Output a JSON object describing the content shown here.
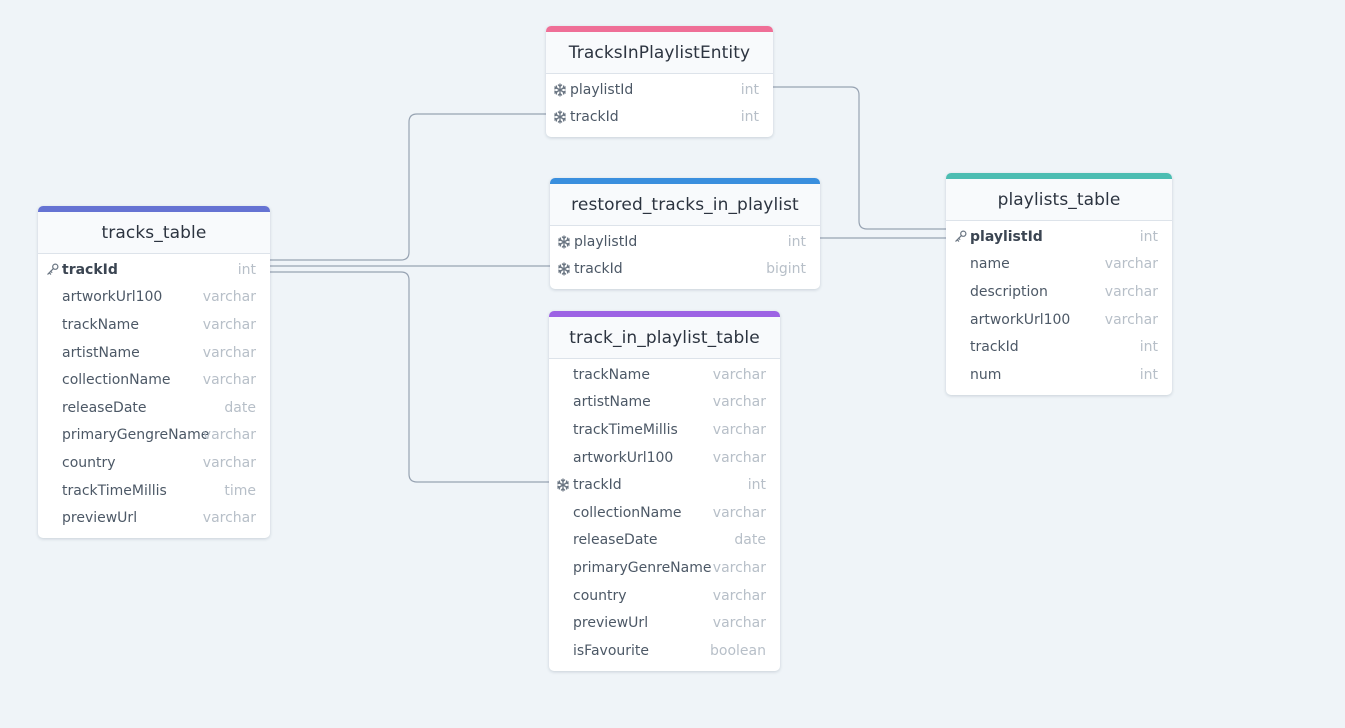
{
  "colors": {
    "background": "#eff4f8",
    "connector": "#97a3b2",
    "tracks_table": "#6573d3",
    "tracks_in_playlist_entity": "#ef6f97",
    "restored_tracks_in_playlist": "#3a8fde",
    "track_in_playlist_table": "#9d63e4",
    "playlists_table": "#4cbdb2"
  },
  "tables": {
    "tracks_table": {
      "title": "tracks_table",
      "color": "#6573d3",
      "fields": [
        {
          "name": "trackId",
          "type": "int",
          "marker": "key-icon",
          "pk": true
        },
        {
          "name": "artworkUrl100",
          "type": "varchar",
          "marker": "",
          "pk": false
        },
        {
          "name": "trackName",
          "type": "varchar",
          "marker": "",
          "pk": false
        },
        {
          "name": "artistName",
          "type": "varchar",
          "marker": "",
          "pk": false
        },
        {
          "name": "collectionName",
          "type": "varchar",
          "marker": "",
          "pk": false
        },
        {
          "name": "releaseDate",
          "type": "date",
          "marker": "",
          "pk": false
        },
        {
          "name": "primaryGengreName",
          "type": "varchar",
          "marker": "",
          "pk": false
        },
        {
          "name": "country",
          "type": "varchar",
          "marker": "",
          "pk": false
        },
        {
          "name": "trackTimeMillis",
          "type": "time",
          "marker": "",
          "pk": false
        },
        {
          "name": "previewUrl",
          "type": "varchar",
          "marker": "",
          "pk": false
        }
      ]
    },
    "tracks_in_playlist_entity": {
      "title": "TracksInPlaylistEntity",
      "color": "#ef6f97",
      "fields": [
        {
          "name": "playlistId",
          "type": "int",
          "marker": "snowflake-icon",
          "pk": false
        },
        {
          "name": "trackId",
          "type": "int",
          "marker": "snowflake-icon",
          "pk": false
        }
      ]
    },
    "restored_tracks_in_playlist": {
      "title": "restored_tracks_in_playlist",
      "color": "#3a8fde",
      "fields": [
        {
          "name": "playlistId",
          "type": "int",
          "marker": "snowflake-icon",
          "pk": false
        },
        {
          "name": "trackId",
          "type": "bigint",
          "marker": "snowflake-icon",
          "pk": false
        }
      ]
    },
    "track_in_playlist_table": {
      "title": "track_in_playlist_table",
      "color": "#9d63e4",
      "fields": [
        {
          "name": "trackName",
          "type": "varchar",
          "marker": "",
          "pk": false
        },
        {
          "name": "artistName",
          "type": "varchar",
          "marker": "",
          "pk": false
        },
        {
          "name": "trackTimeMillis",
          "type": "varchar",
          "marker": "",
          "pk": false
        },
        {
          "name": "artworkUrl100",
          "type": "varchar",
          "marker": "",
          "pk": false
        },
        {
          "name": "trackId",
          "type": "int",
          "marker": "snowflake-icon",
          "pk": false
        },
        {
          "name": "collectionName",
          "type": "varchar",
          "marker": "",
          "pk": false
        },
        {
          "name": "releaseDate",
          "type": "date",
          "marker": "",
          "pk": false
        },
        {
          "name": "primaryGenreName",
          "type": "varchar",
          "marker": "",
          "pk": false
        },
        {
          "name": "country",
          "type": "varchar",
          "marker": "",
          "pk": false
        },
        {
          "name": "previewUrl",
          "type": "varchar",
          "marker": "",
          "pk": false
        },
        {
          "name": "isFavourite",
          "type": "boolean",
          "marker": "",
          "pk": false
        }
      ]
    },
    "playlists_table": {
      "title": "playlists_table",
      "color": "#4cbdb2",
      "fields": [
        {
          "name": "playlistId",
          "type": "int",
          "marker": "key-icon",
          "pk": true
        },
        {
          "name": "name",
          "type": "varchar",
          "marker": "",
          "pk": false
        },
        {
          "name": "description",
          "type": "varchar",
          "marker": "",
          "pk": false
        },
        {
          "name": "artworkUrl100",
          "type": "varchar",
          "marker": "",
          "pk": false
        },
        {
          "name": "trackId",
          "type": "int",
          "marker": "",
          "pk": false
        },
        {
          "name": "num",
          "type": "int",
          "marker": "",
          "pk": false
        }
      ]
    }
  },
  "relationships": [
    {
      "from": "tracks_table.trackId",
      "to": "TracksInPlaylistEntity.trackId"
    },
    {
      "from": "tracks_table.trackId",
      "to": "restored_tracks_in_playlist.trackId"
    },
    {
      "from": "tracks_table.trackId",
      "to": "track_in_playlist_table.trackId"
    },
    {
      "from": "TracksInPlaylistEntity.playlistId",
      "to": "playlists_table.playlistId"
    },
    {
      "from": "restored_tracks_in_playlist.playlistId",
      "to": "playlists_table.playlistId"
    }
  ]
}
